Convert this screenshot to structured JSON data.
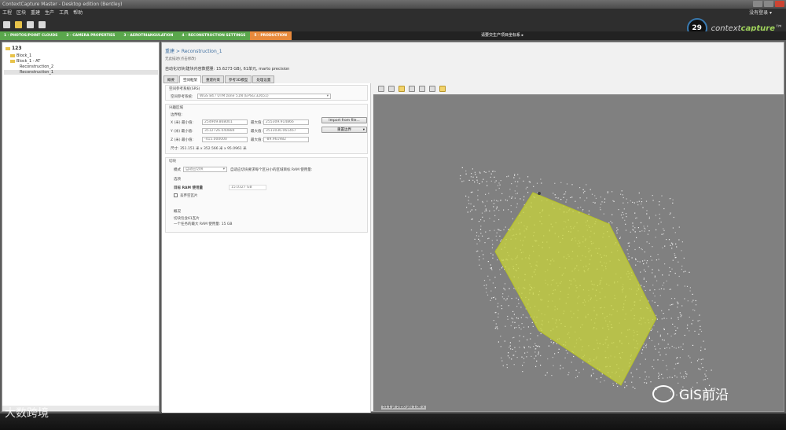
{
  "window": {
    "title": "ContextCapture Master - Desktop edition (Bentley)"
  },
  "menu": {
    "items": [
      "工程",
      "区块",
      "重建",
      "生产",
      "工具",
      "帮助"
    ],
    "right_label": "没有登录 ▾"
  },
  "toolbar": {
    "icons": [
      "new-project-icon",
      "open-project-icon",
      "save-icon",
      "settings-icon"
    ]
  },
  "brand": {
    "clock_value": "29",
    "logo_prefix": "context",
    "logo_main": "capture",
    "logo_suffix": "™"
  },
  "stepbar": {
    "steps": [
      "1 · PHOTOS/POINT CLOUDS",
      "2 · CAMERA PROPERTIES",
      "3 · AEROTRIANGULATION",
      "4 · RECONSTRUCTION SETTINGS",
      "5 · PRODUCTION"
    ],
    "center_text": "请要交生产项目坐标系 ▸"
  },
  "tree": {
    "root": "123",
    "items": [
      "Block_1",
      "Block_1 - AT",
      "Reconstruction_2",
      "Reconstruction_1"
    ]
  },
  "main": {
    "breadcrumb": "重建 > Reconstruction_1",
    "subcrumb": "无此描述(点击修改)",
    "description": "自动化切块/建块内容数据量: 15.6273 GB), 61单元, marto precision",
    "tabs": [
      "概要",
      "空间框架",
      "重建约束",
      "参考3D模型",
      "处理设置"
    ],
    "form": {
      "srs_section_label": "空间参考系统(SRS)",
      "srs_label": "空间参考系统:",
      "srs_value": "WGS 84 / UTM zone 51N (EPSG:32651)",
      "region_section_label": "兴趣区域",
      "bbox_label": "边界框:",
      "x_label": "X (米) 最小值:",
      "x_min": "254909.868001",
      "x_max_label": "最大值:",
      "x_max": "255309.914866",
      "y_label": "Y (米) 最小值:",
      "y_min": "3512726.040884",
      "y_max_label": "最大值:",
      "y_max": "3513036.061467",
      "z_label": "Z (米) 最小值:",
      "z_min": "-415.000000",
      "z_max_label": "最大值:",
      "z_max": "-89.961982",
      "size_text": "尺寸: 351.151 米 x 352.566 米 x 95.0961 米",
      "import_button": "Import from file...",
      "reset_button": "重置边界",
      "tiling_section_label": "切块",
      "mode_label": "模式",
      "mode_value": "自适应切块",
      "mode_hint": "自适应切块要求每个区分小的区域目标 RAM 使用量:",
      "options_label": "选项",
      "ram_label": "目标 RAM 使用量",
      "ram_value": "15.0327 GB",
      "discard_label": "丢弃空瓦片",
      "summary_label": "概况",
      "summary_line1": "切块包含61瓦片",
      "summary_line2": "一个任务的最大 RAM 使用量: 15 GB"
    }
  },
  "viewer": {
    "toolbar_icons": [
      "home-view-icon",
      "zoom-icon",
      "box-view-icon",
      "grid-icon",
      "camera-icon",
      "photo-icon",
      "tile-icon"
    ],
    "status_text": "51.1 pt   2450 pts   1.00 x"
  },
  "watermarks": {
    "left": "大数跨境",
    "right": "GIS前沿"
  }
}
